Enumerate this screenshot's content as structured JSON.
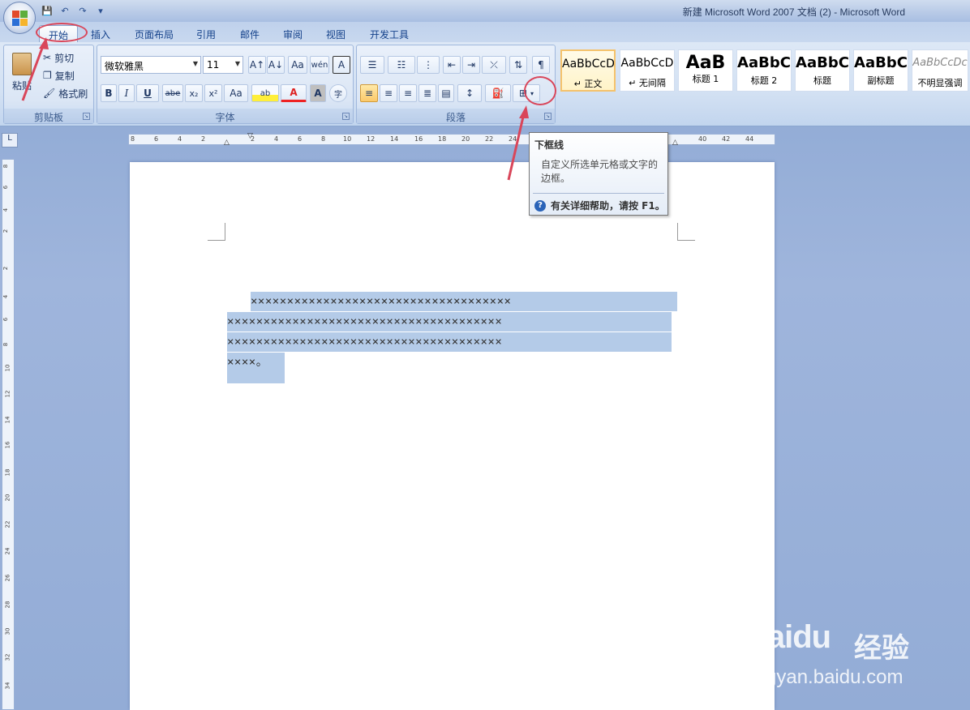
{
  "window": {
    "title": "新建 Microsoft Word 2007 文档 (2) - Microsoft Word"
  },
  "quick_access": {
    "save": "💾",
    "undo": "↶",
    "redo": "↷",
    "more": "▾"
  },
  "tabs": [
    {
      "label": "开始",
      "active": true
    },
    {
      "label": "插入"
    },
    {
      "label": "页面布局"
    },
    {
      "label": "引用"
    },
    {
      "label": "邮件"
    },
    {
      "label": "审阅"
    },
    {
      "label": "视图"
    },
    {
      "label": "开发工具"
    }
  ],
  "clipboard": {
    "paste": "粘贴",
    "cut": "剪切",
    "copy": "复制",
    "format_painter": "格式刷",
    "group_label": "剪贴板"
  },
  "font": {
    "family": "微软雅黑",
    "size": "11",
    "group_label": "字体",
    "grow": "A↑",
    "shrink": "A↓",
    "clear": "Aa",
    "phonetic": "wén",
    "border_char": "A",
    "bold": "B",
    "italic": "I",
    "underline": "U",
    "strike": "abe",
    "sub": "x₂",
    "sup": "x²",
    "case": "Aa",
    "highlight": "ab",
    "color": "A",
    "shade": "A",
    "enclose": "字"
  },
  "paragraph": {
    "group_label": "段落"
  },
  "styles": [
    {
      "sample": "AaBbCcD",
      "name": "↵ 正文",
      "selected": true
    },
    {
      "sample": "AaBbCcD",
      "name": "↵ 无间隔"
    },
    {
      "sample": "AaB",
      "name": "标题 1"
    },
    {
      "sample": "AaBbC",
      "name": "标题 2"
    },
    {
      "sample": "AaBbC",
      "name": "标题"
    },
    {
      "sample": "AaBbC",
      "name": "副标题"
    },
    {
      "sample": "AaBbCcDc",
      "name": "不明显强调"
    }
  ],
  "ruler": {
    "corner": "L",
    "ticks": [
      "8",
      "6",
      "4",
      "2",
      "2",
      "4",
      "6",
      "8",
      "10",
      "12",
      "14",
      "16",
      "18",
      "20",
      "22",
      "24",
      "40",
      "42",
      "44"
    ],
    "vticks": [
      "8",
      "6",
      "4",
      "2",
      "2",
      "4",
      "6",
      "8",
      "10",
      "12",
      "14",
      "16",
      "18",
      "20",
      "22",
      "24",
      "26",
      "28",
      "30",
      "32",
      "34"
    ]
  },
  "tooltip": {
    "title": "下框线",
    "description": "自定义所选单元格或文字的边框。",
    "help_icon": "?",
    "help": "有关详细帮助，请按 F1。"
  },
  "document": {
    "lines": [
      "××××××××××××××××××××××××××××××××××××",
      "××××××××××××××××××××××××××××××××××××××",
      "××××××××××××××××××××××××××××××××××××××",
      "××××。"
    ]
  },
  "watermark": {
    "brand": "Baidu",
    "cn": "经验",
    "url": "jingyan.baidu.com"
  },
  "colors": {
    "accent_red": "#d9465a",
    "selection": "#b4cbe8",
    "ribbon": "#dbe6f5"
  }
}
